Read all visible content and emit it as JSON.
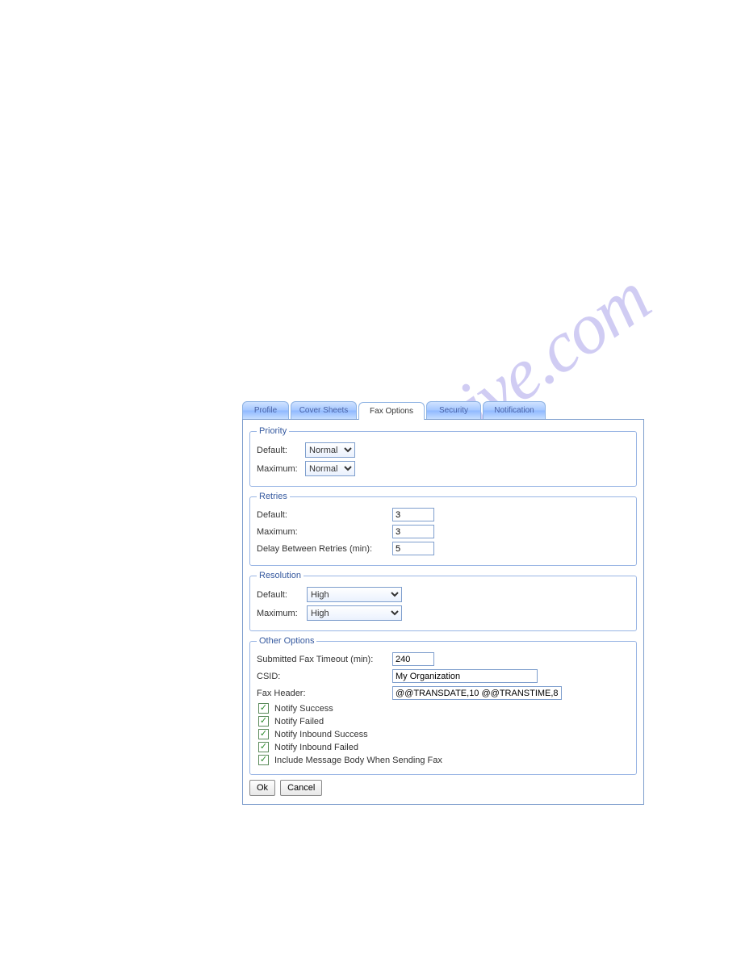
{
  "watermark": "manualshive.com",
  "tabs": {
    "profile": "Profile",
    "cover": "Cover Sheets",
    "fax": "Fax Options",
    "security": "Security",
    "notification": "Notification"
  },
  "priority": {
    "legend": "Priority",
    "default_label": "Default:",
    "default_value": "Normal",
    "maximum_label": "Maximum:",
    "maximum_value": "Normal"
  },
  "retries": {
    "legend": "Retries",
    "default_label": "Default:",
    "default_value": "3",
    "maximum_label": "Maximum:",
    "maximum_value": "3",
    "delay_label": "Delay Between Retries (min):",
    "delay_value": "5"
  },
  "resolution": {
    "legend": "Resolution",
    "default_label": "Default:",
    "default_value": "High",
    "maximum_label": "Maximum:",
    "maximum_value": "High"
  },
  "other": {
    "legend": "Other Options",
    "timeout_label": "Submitted Fax Timeout (min):",
    "timeout_value": "240",
    "csid_label": "CSID:",
    "csid_value": "My Organization",
    "header_label": "Fax Header:",
    "header_value": "@@TRANSDATE,10 @@TRANSTIME,8",
    "cb1": "Notify Success",
    "cb2": "Notify Failed",
    "cb3": "Notify Inbound Success",
    "cb4": "Notify Inbound Failed",
    "cb5": "Include Message Body When Sending Fax"
  },
  "buttons": {
    "ok": "Ok",
    "cancel": "Cancel"
  }
}
